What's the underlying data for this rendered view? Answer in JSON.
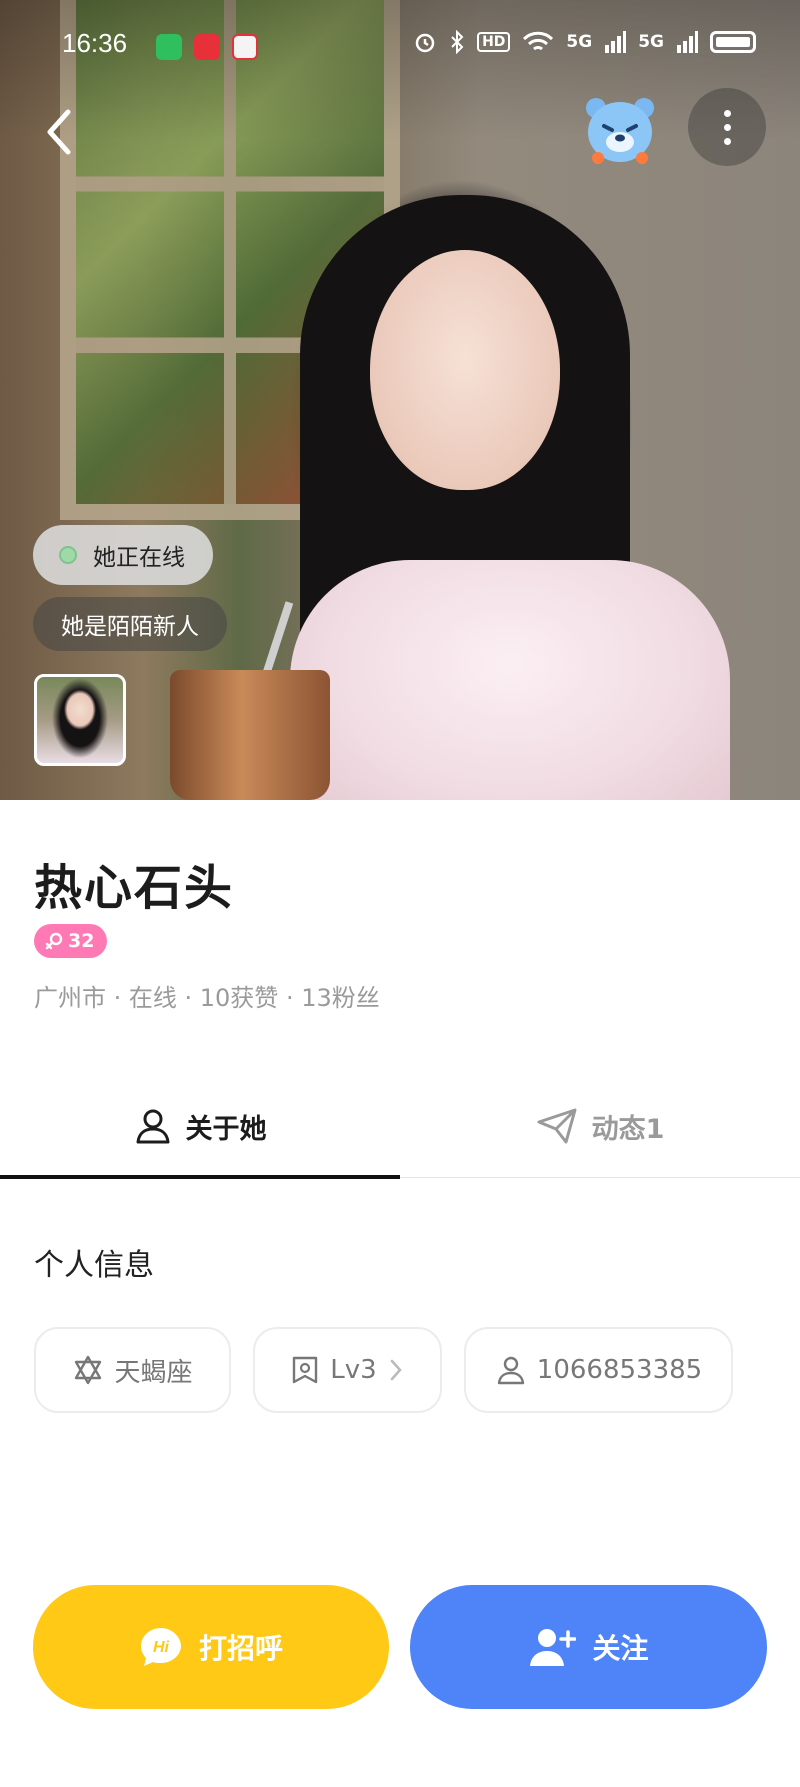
{
  "status_bar": {
    "time": "16:36",
    "network_hd": "HD",
    "network_5g_1": "5G",
    "network_5g_2": "5G"
  },
  "hero": {
    "online_status": "她正在线",
    "newbie_label": "她是陌陌新人"
  },
  "profile": {
    "name": "热心石头",
    "gender_age": "32",
    "meta": "广州市 · 在线 · 10获赞 · 13粉丝"
  },
  "tabs": [
    {
      "label": "关于她",
      "active": true
    },
    {
      "label": "动态1",
      "active": false
    }
  ],
  "personal_info": {
    "title": "个人信息",
    "zodiac": "天蝎座",
    "level": "Lv3",
    "user_id": "1066853385"
  },
  "actions": {
    "greet_label": "打招呼",
    "greet_icon_text": "Hi",
    "follow_label": "关注"
  },
  "colors": {
    "greet_button": "#ffc915",
    "follow_button": "#4f84f8",
    "gender_badge": "#ff7ab5",
    "online_dot": "#9fd9a8"
  }
}
